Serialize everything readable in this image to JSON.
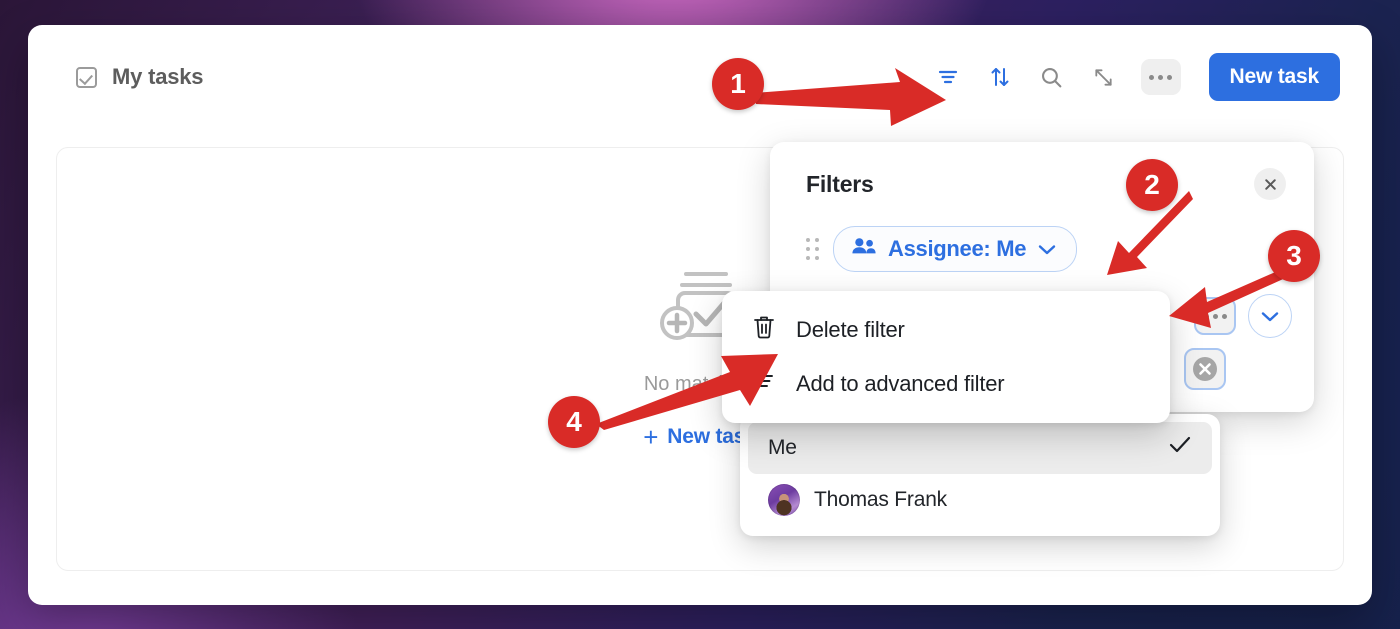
{
  "header": {
    "title": "My tasks",
    "checkbox_icon": "checkbox-checked-icon",
    "toolbar": {
      "filter_icon": "filter-icon",
      "sort_icon": "sort-arrows-icon",
      "search_icon": "search-icon",
      "expand_icon": "expand-diagonal-icon",
      "more_icon": "more-horizontal-icon",
      "new_task_label": "New task"
    }
  },
  "empty_state": {
    "icon": "add-task-stack-icon",
    "message": "No matching",
    "new_task_label": "New task",
    "plus_glyph": "+"
  },
  "filters_popover": {
    "title": "Filters",
    "close_icon": "close-icon",
    "drag_handle_icon": "drag-handle-icon",
    "chip": {
      "icon": "people-icon",
      "label": "Assignee: Me",
      "chevron_icon": "chevron-down-icon"
    },
    "row_actions": {
      "more_icon": "more-horizontal-icon",
      "chevron_icon": "chevron-down-icon",
      "clear_icon": "clear-circle-icon"
    }
  },
  "context_menu": {
    "items": [
      {
        "label": "Delete filter",
        "icon": "trash-icon"
      },
      {
        "label": "Add to advanced filter",
        "icon": "filter-icon"
      }
    ]
  },
  "assignee_dropdown": {
    "items": [
      {
        "label": "Me",
        "selected": true,
        "check_icon": "check-icon"
      },
      {
        "label": "Thomas Frank",
        "selected": false,
        "avatar": "user-avatar"
      }
    ]
  },
  "callouts": [
    {
      "number": "1"
    },
    {
      "number": "2"
    },
    {
      "number": "3"
    },
    {
      "number": "4"
    }
  ],
  "colors": {
    "accent_blue": "#2d6fe0",
    "callout_red": "#d92b27",
    "muted_text": "#9a9a9a",
    "panel_white": "#ffffff"
  }
}
